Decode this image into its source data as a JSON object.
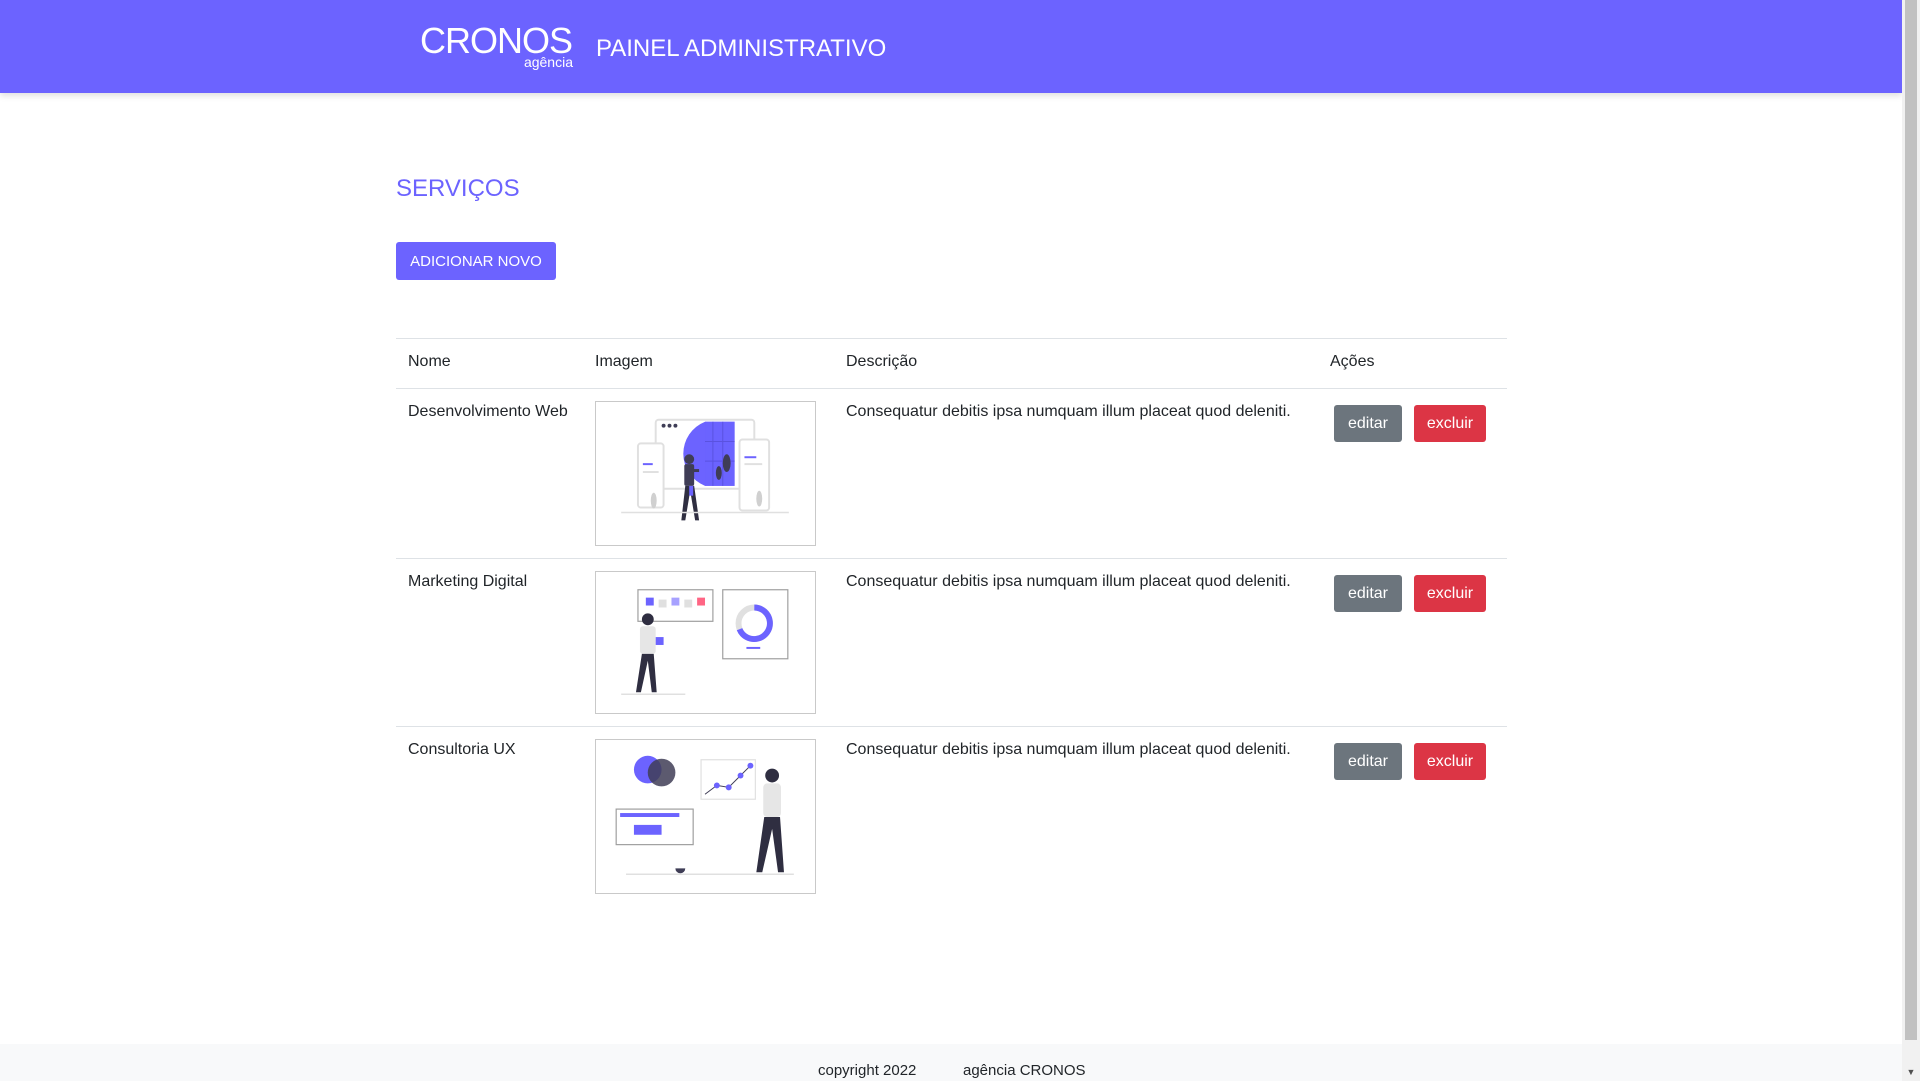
{
  "header": {
    "logo_main": "CRONOS",
    "logo_sub": "agência",
    "title": "PAINEL ADMINISTRATIVO",
    "bg_color": "#6c63ff"
  },
  "main": {
    "section_title": "SERVIÇOS",
    "add_button_label": "ADICIONAR NOVO"
  },
  "table": {
    "columns": [
      "Nome",
      "Imagem",
      "Descrição",
      "Ações"
    ],
    "rows": [
      {
        "name": "Desenvolvimento Web",
        "image": "web-development-illustration",
        "description": "Consequatur debitis ipsa numquam illum placeat quod deleniti.",
        "edit_label": "editar",
        "delete_label": "excluir"
      },
      {
        "name": "Marketing Digital",
        "image": "digital-marketing-illustration",
        "description": "Consequatur debitis ipsa numquam illum placeat quod deleniti.",
        "edit_label": "editar",
        "delete_label": "excluir"
      },
      {
        "name": "Consultoria UX",
        "image": "ux-consulting-illustration",
        "description": "Consequatur debitis ipsa numquam illum placeat quod deleniti.",
        "edit_label": "editar",
        "delete_label": "excluir"
      }
    ]
  },
  "footer": {
    "copyright": "copyright 2022",
    "brand": "agência CRONOS"
  },
  "colors": {
    "accent": "#6c63ff",
    "edit_button": "#6c757d",
    "delete_button": "#dc3545"
  }
}
